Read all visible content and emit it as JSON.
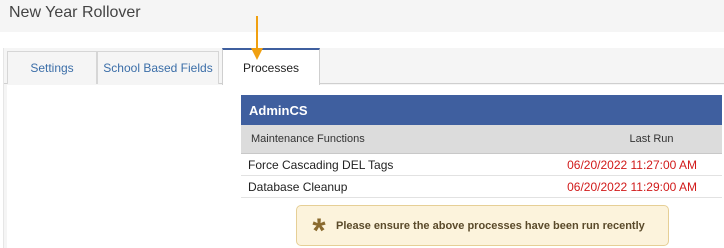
{
  "page": {
    "title": "New Year Rollover"
  },
  "tabs": [
    {
      "label": "Settings",
      "active": false
    },
    {
      "label": "School Based Fields",
      "active": false
    },
    {
      "label": "Processes",
      "active": true
    }
  ],
  "panel": {
    "title": "AdminCS",
    "columns": {
      "function": "Maintenance Functions",
      "last_run": "Last Run"
    },
    "rows": [
      {
        "name": "Force Cascading DEL Tags",
        "last_run": "06/20/2022 11:27:00 AM"
      },
      {
        "name": "Database Cleanup",
        "last_run": "06/20/2022 11:29:00 AM"
      }
    ]
  },
  "notice": {
    "icon": "asterisk-icon",
    "text": "Please ensure the above processes have been run recently"
  },
  "annotation": {
    "icon": "arrow-down-icon",
    "color": "#f0a010"
  },
  "colors": {
    "header_bg": "#3f5f9f",
    "last_run_text": "#d11a1a",
    "tab_link": "#3b6ea8"
  }
}
